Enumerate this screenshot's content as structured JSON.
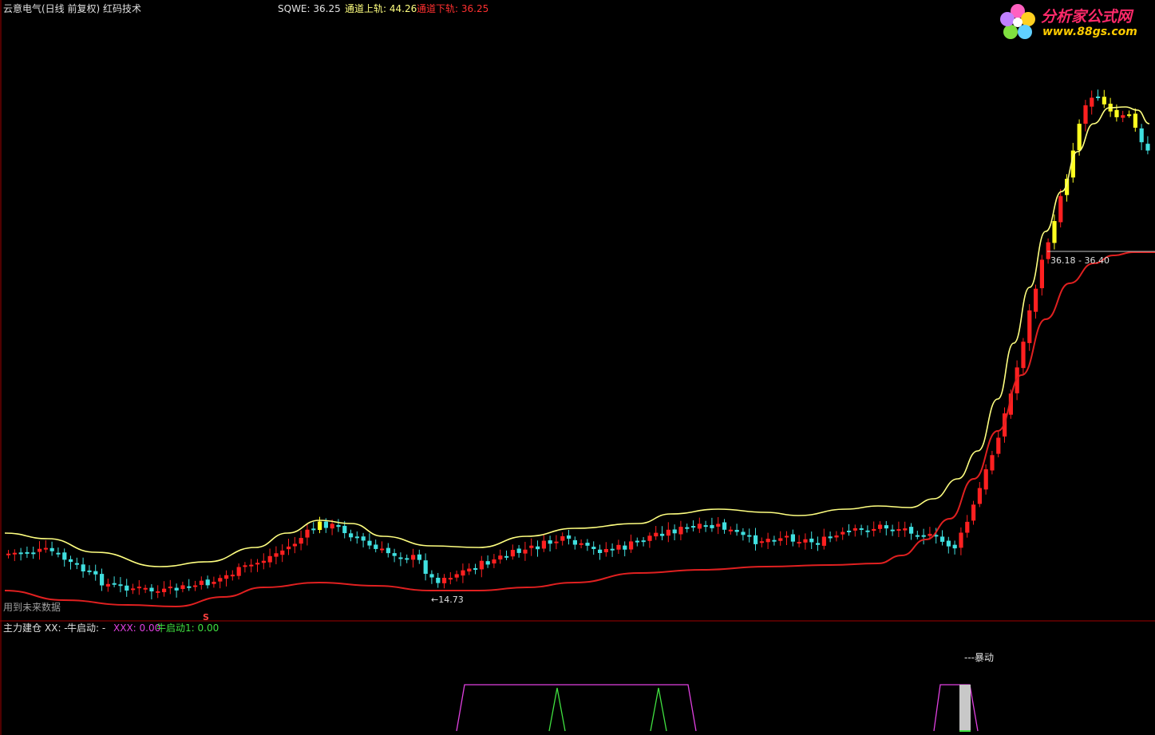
{
  "header": {
    "title": "云意电气(日线 前复权) 红码技术",
    "sqwe_label": "SQWE: 36.25",
    "upper_label": "通道上轨: 44.26",
    "lower_label": "通道下轨: 36.25"
  },
  "logo": {
    "name": "分析家公式网",
    "url": "www.88gs.com"
  },
  "main_chart": {
    "future_data_note": "用到未来数据",
    "low_marker": "←14.73",
    "price_range_label": "36.18 - 36.40",
    "s_marker": "S"
  },
  "indicator": {
    "name": "主力建仓",
    "xx_label": "XX: -",
    "niu_label": "牛启动: -",
    "xxx_label": "XXX: 0.00",
    "niu1_label": "牛启动1: 0.00",
    "baodong_label": "---暴动"
  },
  "colors": {
    "background": "#000000",
    "up_candle": "#ff2020",
    "down_candle": "#40e0e0",
    "signal_candle": "#ffff20",
    "upper_band": "#ffff80",
    "lower_band": "#e02020",
    "magenta_line": "#e040e0",
    "green_line": "#40e040"
  }
}
